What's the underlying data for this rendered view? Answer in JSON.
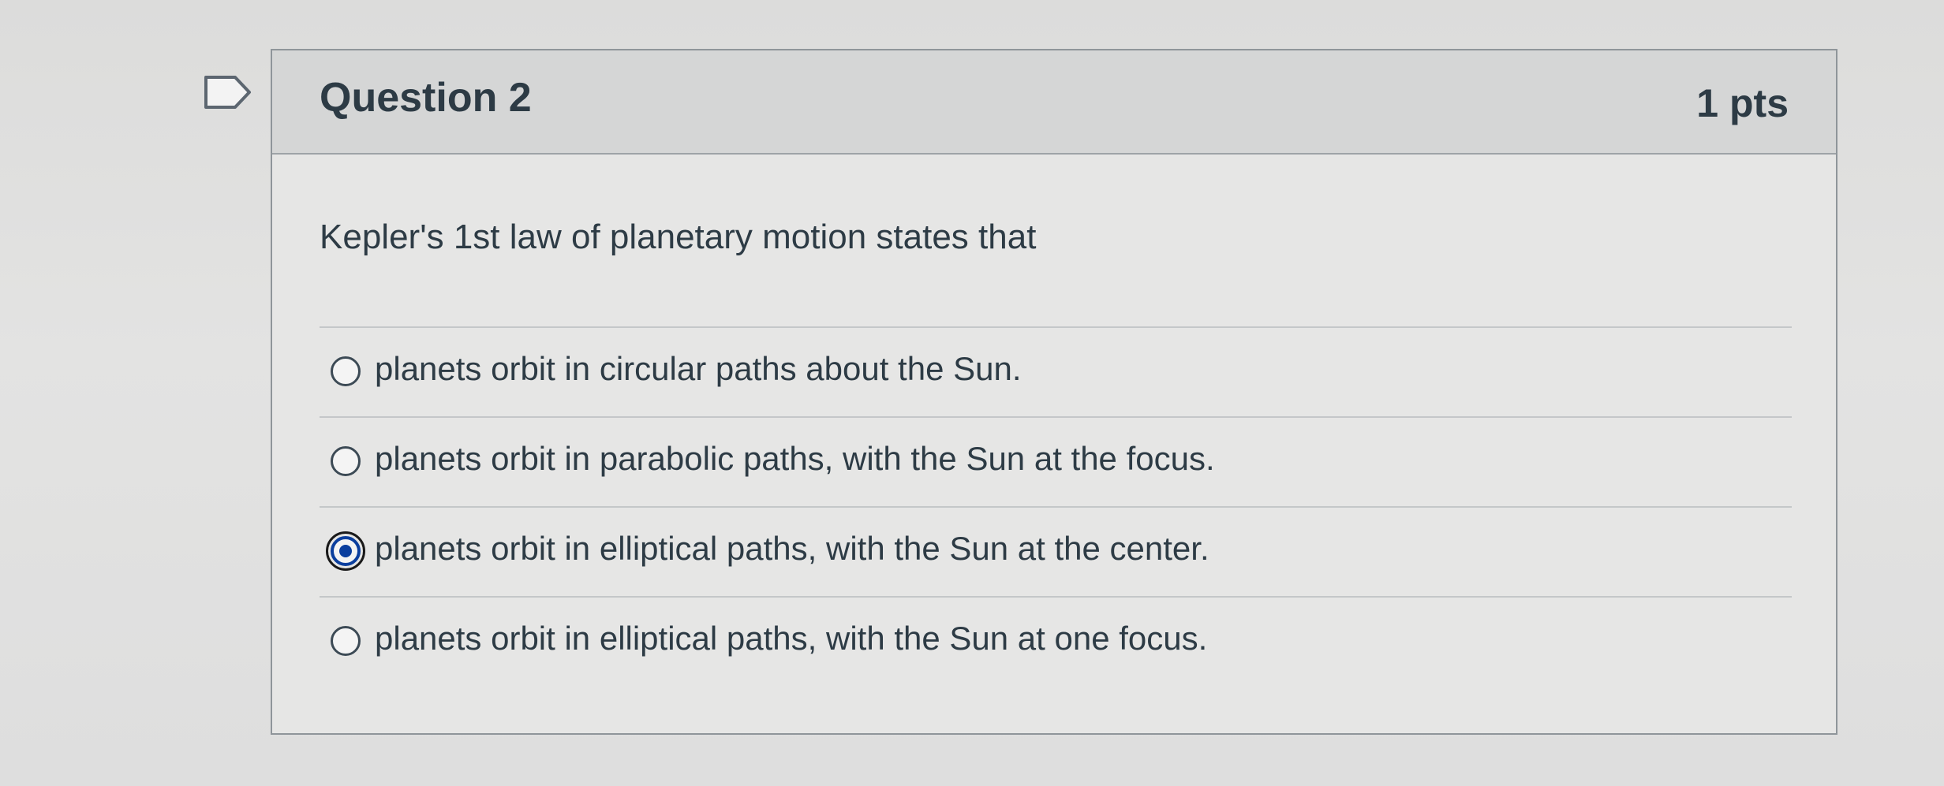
{
  "question": {
    "title": "Question 2",
    "points": "1 pts",
    "text": "Kepler's 1st law of planetary motion states that"
  },
  "answers": [
    {
      "label": "planets orbit in circular paths about the Sun.",
      "selected": false
    },
    {
      "label": "planets orbit in parabolic paths, with the Sun at the focus.",
      "selected": false
    },
    {
      "label": "planets orbit in elliptical paths, with the Sun at the center.",
      "selected": true
    },
    {
      "label": "planets orbit in elliptical paths, with the Sun at one focus.",
      "selected": false
    }
  ],
  "colors": {
    "accent": "#0b3f9e",
    "text": "#2d3b45"
  },
  "icons": {
    "flag": "flag-question-icon"
  }
}
